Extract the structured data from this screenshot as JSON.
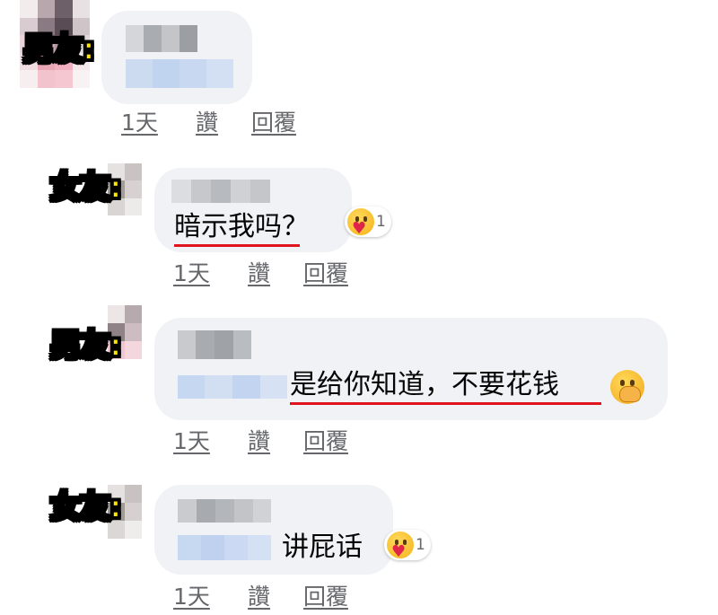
{
  "tags": {
    "boyfriend": "男友:",
    "girlfriend": "女友:"
  },
  "meta": {
    "time": "1天",
    "like": "讚",
    "reply": "回覆"
  },
  "comments": [
    {
      "speaker": "男友:",
      "text": "",
      "time": "1天",
      "like": "讚",
      "reply": "回覆"
    },
    {
      "speaker": "女友:",
      "text": "暗示我吗？",
      "reaction": "hug-emoji",
      "reaction_count": "1",
      "time": "1天",
      "like": "讚",
      "reply": "回覆"
    },
    {
      "speaker": "男友:",
      "text": "是给你知道，不要花钱",
      "trailing_emoji": "hand-over-mouth-emoji",
      "time": "1天",
      "like": "讚",
      "reply": "回覆"
    },
    {
      "speaker": "女友:",
      "text": "讲屁话",
      "reaction": "hug-emoji",
      "reaction_count": "1",
      "time": "1天",
      "like": "讚",
      "reply": "回覆"
    }
  ],
  "colors": {
    "bubble": "#f0f2f5",
    "meta_text": "#65676b",
    "underline": "#e0141e",
    "tag_fill": "#ffe500",
    "blurred_name": "#c8ccd1",
    "blurred_link": "#c4d6f0"
  }
}
